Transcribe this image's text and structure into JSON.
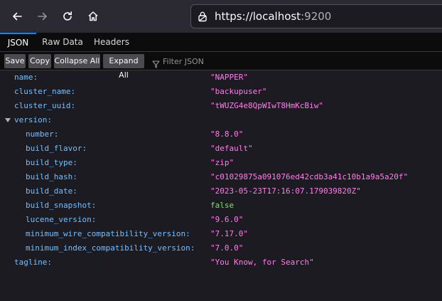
{
  "browser": {
    "url_main": "https://localhost",
    "url_port": ":9200",
    "back_icon": "arrow-left-icon",
    "forward_icon": "arrow-right-icon",
    "reload_icon": "reload-icon",
    "home_icon": "home-icon",
    "lock_icon": "lock-icon"
  },
  "tabs": [
    {
      "label": "JSON",
      "active": true
    },
    {
      "label": "Raw Data",
      "active": false
    },
    {
      "label": "Headers",
      "active": false
    }
  ],
  "toolbar": {
    "save": "Save",
    "copy": "Copy",
    "collapse_all": "Collapse All",
    "expand_all": "Expand All",
    "filter_placeholder": "Filter JSON",
    "filter_icon": "funnel-icon"
  },
  "json": {
    "name": {
      "key": "name:",
      "value": "\"NAPPER\""
    },
    "cluster_name": {
      "key": "cluster_name:",
      "value": "\"backupuser\""
    },
    "cluster_uuid": {
      "key": "cluster_uuid:",
      "value": "\"tWUZG4e8QpWIwT8HmKcBiw\""
    },
    "version": {
      "key": "version:",
      "expanded": true,
      "number": {
        "key": "number:",
        "value": "\"8.8.0\""
      },
      "build_flavor": {
        "key": "build_flavor:",
        "value": "\"default\""
      },
      "build_type": {
        "key": "build_type:",
        "value": "\"zip\""
      },
      "build_hash": {
        "key": "build_hash:",
        "value": "\"c01029875a091076ed42cdb3a41c10b1a9a5a20f\""
      },
      "build_date": {
        "key": "build_date:",
        "value": "\"2023-05-23T17:16:07.179039820Z\""
      },
      "build_snapshot": {
        "key": "build_snapshot:",
        "value": "false"
      },
      "lucene_version": {
        "key": "lucene_version:",
        "value": "\"9.6.0\""
      },
      "minimum_wire_compatibility_version": {
        "key": "minimum_wire_compatibility_version:",
        "value": "\"7.17.0\""
      },
      "minimum_index_compatibility_version": {
        "key": "minimum_index_compatibility_version:",
        "value": "\"7.0.0\""
      }
    },
    "tagline": {
      "key": "tagline:",
      "value": "\"You Know, for Search\""
    }
  },
  "colors": {
    "key": "#75bfff",
    "string": "#ff7de9",
    "boolean": "#86de74",
    "accent": "#0a84ff"
  }
}
